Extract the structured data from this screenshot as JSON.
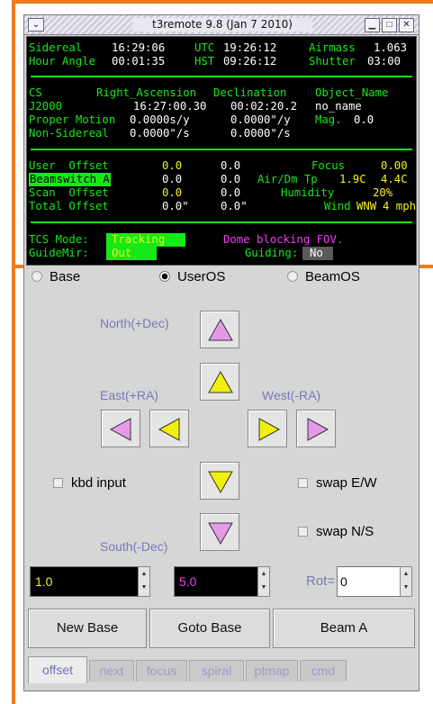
{
  "window": {
    "title": "t3remote 9.8 (Jan  7 2010)",
    "menu_glyph": "⌄",
    "min_glyph": "▁",
    "max_glyph": "□",
    "close_glyph": "✕"
  },
  "status": {
    "sidereal_label": "Sidereal",
    "sidereal": "16:29:06",
    "utc_label": "UTC",
    "utc": "19:26:12",
    "airmass_label": "Airmass",
    "airmass": "1.063",
    "hour_angle_label": "Hour Angle",
    "hour_angle": "00:01:35",
    "hst_label": "HST",
    "hst": "09:26:12",
    "shutter_label": "Shutter",
    "shutter": "03:00",
    "cs_label": "CS",
    "ra_header": "Right_Ascension",
    "dec_header": "Declination",
    "obj_header": "Object_Name",
    "cs": "J2000",
    "ra": "16:27:00.30",
    "dec": "00:02:20.2",
    "object": "no_name",
    "pm_label": "Proper Motion",
    "pm_ra": "0.0000s/y",
    "pm_dec": "0.0000\"/y",
    "mag_label": "Mag.",
    "mag": "0.0",
    "ns_label": "Non-Sidereal",
    "ns_ra": "0.0000\"/s",
    "ns_dec": "0.0000\"/s",
    "user_offset_label": "User  Offset",
    "user_offset_ra": "0.0",
    "user_offset_dec": "0.0",
    "focus_label": "Focus",
    "focus": "0.00",
    "beamswitch_label": "Beamswitch A",
    "beamswitch_ra": "0.0",
    "beamswitch_dec": "0.0",
    "airdm_label": "Air/Dm Tp",
    "air_tp": "1.9C",
    "dm_tp": "4.4C",
    "scan_label": "Scan  Offset",
    "scan_ra": "0.0",
    "scan_dec": "0.0",
    "humidity_label": "Humidity",
    "humidity": "20%",
    "total_label": "Total Offset",
    "total_ra": "0.0\"",
    "total_dec": "0.0\"",
    "wind_label": "Wind",
    "wind_dir": "WNW",
    "wind_speed": "4 mph",
    "tcs_mode_label": "TCS Mode:",
    "tcs_mode": "Tracking",
    "dome_msg": "Dome blocking FOV.",
    "guidemir_label": "GuideMir:",
    "guidemir": "Out",
    "guiding_label": "Guiding:",
    "guiding": "No"
  },
  "controls": {
    "radio_base": "Base",
    "radio_useros": "UserOS",
    "radio_beamos": "BeamOS",
    "selected_radio": "UserOS",
    "north_label": "North(+Dec)",
    "east_label": "East(+RA)",
    "west_label": "West(-RA)",
    "south_label": "South(-Dec)",
    "kbd_input": "kbd input",
    "swap_ew": "swap E/W",
    "swap_ns": "swap N/S",
    "step_small": "1.0",
    "step_large": "5.0",
    "rot_label": "Rot=",
    "rot_value": "0",
    "spin_up": "▲",
    "spin_down": "▼",
    "new_base": "New Base",
    "goto_base": "Goto Base",
    "beam_a": "Beam A",
    "arrow_magenta": "#e59ae8",
    "arrow_yellow": "#f0f00c"
  },
  "tabs": [
    "offset",
    "next",
    "focus",
    "spiral",
    "ptmap",
    "cmd"
  ],
  "active_tab": "offset",
  "colors": {
    "highlight_frame": "#f07a1e",
    "status_green": "#17e817",
    "status_yellow": "#f2f21e",
    "status_magenta": "#f13cf1",
    "label_blue": "#7879b8"
  }
}
